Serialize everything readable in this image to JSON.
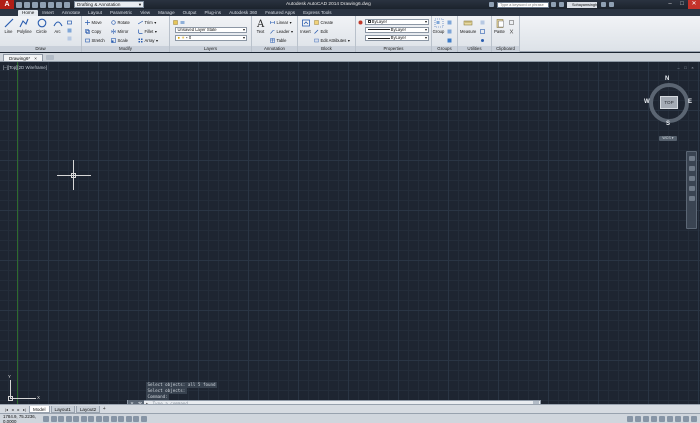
{
  "window": {
    "app_button": "A",
    "workspace": "Drafting & Annotation",
    "title": "Autodesk AutoCAD 2014    Drawing6.dwg",
    "search_placeholder": "Type a keyword or phrase",
    "user": "Sohayamsingh",
    "controls": [
      "–",
      "□",
      "✕"
    ]
  },
  "ribbon_tabs": [
    "Home",
    "Insert",
    "Annotate",
    "Layout",
    "Parametric",
    "View",
    "Manage",
    "Output",
    "Plug-ins",
    "Autodesk 360",
    "Featured Apps",
    "Express Tools"
  ],
  "ribbon": {
    "draw": {
      "title": "Draw",
      "line": "Line",
      "polyline": "Polyline",
      "circle": "Circle",
      "arc": "Arc"
    },
    "modify": {
      "title": "Modify",
      "move": "Move",
      "rotate": "Rotate",
      "trim": "Trim",
      "copy": "Copy",
      "mirror": "Mirror",
      "fillet": "Fillet",
      "stretch": "Stretch",
      "scale": "Scale",
      "array": "Array"
    },
    "layers": {
      "title": "Layers",
      "layer_state": "Unsaved Layer State",
      "layer_current": "0"
    },
    "annotation": {
      "title": "Annotation",
      "text": "Text",
      "linear": "Linear",
      "leader": "Leader",
      "table": "Table"
    },
    "block": {
      "title": "Block",
      "insert": "Insert",
      "create": "Create",
      "edit": "Edit",
      "edit_attributes": "Edit Attributes"
    },
    "properties": {
      "title": "Properties",
      "color": "ByLayer",
      "linetype": "ByLayer",
      "lineweight": "ByLayer"
    },
    "groups": {
      "title": "Groups",
      "group": "Group"
    },
    "utilities": {
      "title": "Utilities",
      "measure": "Measure"
    },
    "clipboard": {
      "title": "Clipboard",
      "paste": "Paste"
    }
  },
  "file_tab": {
    "name": "Drawing6*",
    "close": "×"
  },
  "viewport": {
    "label": "[–][Top][2D Wireframe]",
    "controls": [
      "–",
      "□",
      "×"
    ],
    "viewcube": {
      "n": "N",
      "s": "S",
      "e": "E",
      "w": "W",
      "face": "TOP",
      "wcs": "WCS ▾"
    },
    "ucs": {
      "x": "X",
      "y": "Y"
    }
  },
  "command": {
    "history": [
      "Select objects: all 5 found",
      "Select objects:",
      "Command:"
    ],
    "prompt": "Type a command"
  },
  "layout_tabs": [
    "Model",
    "Layout1",
    "Layout2"
  ],
  "status": {
    "coordinates": "1784.9,  75.2236, 0.0000"
  },
  "colors": {
    "drawing_bg": "#1e2531",
    "app_red": "#b11e16",
    "ribbon_bg": "#e9edf2"
  }
}
